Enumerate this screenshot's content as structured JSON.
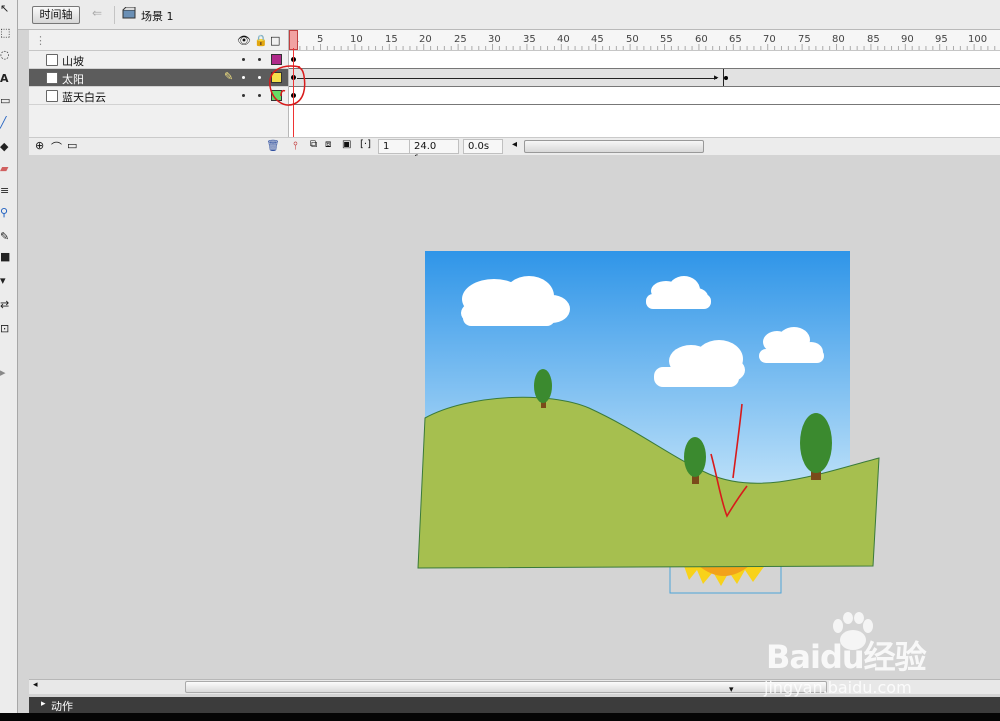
{
  "topbar": {
    "timeline_tab": "时间轴",
    "scene_label": "场景 1"
  },
  "timeline": {
    "frame_numbers": [
      "1",
      "5",
      "10",
      "15",
      "20",
      "25",
      "30",
      "35",
      "40",
      "45",
      "50",
      "55",
      "60",
      "65",
      "70",
      "75",
      "80",
      "85",
      "90",
      "95",
      "100"
    ],
    "layers": [
      {
        "name": "山坡",
        "color": "#b02a8a",
        "selected": false
      },
      {
        "name": "太阳",
        "color": "#f5e04a",
        "selected": true
      },
      {
        "name": "蓝天白云",
        "color": "#66dd66",
        "selected": false
      }
    ],
    "status": {
      "current_frame": "1",
      "fps": "24.0 fps",
      "time": "0.0s"
    }
  },
  "actions_panel": {
    "label": "动作"
  },
  "watermark": {
    "brand": "Baidu经验",
    "url": "jingyan.baidu.com"
  },
  "colors": {
    "sky_top": "#2f95e8",
    "sky_bottom": "#a8d8f7",
    "hill": "#a6bf4f",
    "hill_stroke": "#3a7a3a",
    "tree": "#3b8a2f",
    "trunk": "#7a4a1a",
    "sun": "#f8d21a",
    "annotation": "#d81b1b"
  }
}
